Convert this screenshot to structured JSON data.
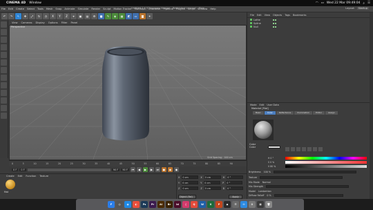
{
  "macbar": {
    "app": "CINEMA 4D",
    "menu": [
      "Window"
    ],
    "clock": "Wed 22 Mar  09:49:04",
    "icons": [
      "wifi-icon",
      "battery-icon",
      "search-icon",
      "list-icon"
    ]
  },
  "c4d": {
    "menu": [
      "File",
      "Edit",
      "Create",
      "Select",
      "Tools",
      "Mesh",
      "Snap",
      "Animate",
      "Simulate",
      "Render",
      "Sculpt",
      "Motion Tracker",
      "MoGraph",
      "Character",
      "Pipeline",
      "Plugins",
      "Script",
      "Window",
      "Help"
    ],
    "title": "Untitled 1 * (Classroom Version - Restricted License) - Main",
    "layout_label": "Layout:",
    "layout_value": "Startup"
  },
  "viewport": {
    "menu": [
      "View",
      "Cameras",
      "Display",
      "Options",
      "Filter",
      "Panel"
    ],
    "label": "Perspective",
    "grid_spacing": "Grid Spacing : 100 cm"
  },
  "timeline": {
    "ticks": [
      "0",
      "5",
      "10",
      "15",
      "20",
      "25",
      "30",
      "35",
      "40",
      "45",
      "50",
      "55",
      "60",
      "65",
      "70",
      "75",
      "80",
      "85",
      "90"
    ],
    "frame_start": "0 F",
    "frame_current": "0 F",
    "frame_end": "90 F",
    "frame_end2": "90 F"
  },
  "material_manager": {
    "menu": [
      "Create",
      "Edit",
      "Function",
      "Texture"
    ],
    "material_name": "Mat"
  },
  "coordinates": {
    "rows": [
      {
        "axis": "X",
        "pos": "0 cm",
        "rot_axis": "X",
        "rot": "0 cm",
        "h": "H",
        "hval": "0 °"
      },
      {
        "axis": "Y",
        "pos": "0 cm",
        "rot_axis": "Y",
        "rot": "0 cm",
        "h": "P",
        "hval": "0 °"
      },
      {
        "axis": "Z",
        "pos": "0 cm",
        "rot_axis": "Z",
        "rot": "0 cm",
        "h": "B",
        "hval": "0 °"
      }
    ],
    "mode": "Object (Rel)",
    "apply": "Apply"
  },
  "objects": {
    "menu": [
      "File",
      "Edit",
      "View",
      "Objects",
      "Tags",
      "Bookmarks"
    ],
    "items": [
      "Lathe",
      "Spline",
      "Null"
    ]
  },
  "attributes": {
    "menu": [
      "Mode",
      "Edit",
      "User Data"
    ],
    "title": "Material [Mat]",
    "tabs": [
      "Basic",
      "Color",
      "Reflectance",
      "Illumination",
      "Editor",
      "Assign"
    ],
    "active_tab": "Color",
    "section": "Color",
    "color_label": "Color",
    "h_label": "H",
    "h_val": "0 °",
    "s_label": "S",
    "s_val": "0 %",
    "v_label": "V",
    "v_val": "80 %",
    "brightness_label": "Brightness",
    "brightness_val": "100 %",
    "texture_label": "Texture",
    "mix_label": "Mix Mode",
    "mix_val": "Normal",
    "mixstrength_label": "Mix Strength",
    "model_label": "Model",
    "model_val": "Lambertian",
    "diffuse_label": "Diffuse Falloff",
    "diffuse_val": "0 %"
  },
  "dock": {
    "apps": [
      {
        "label": "F",
        "color": "#2b7de9",
        "name": "finder-icon"
      },
      {
        "label": "◎",
        "color": "#555",
        "name": "launchpad-icon"
      },
      {
        "label": "◉",
        "color": "#1e88e5",
        "name": "safari-icon"
      },
      {
        "label": "◐",
        "color": "#e94e3b",
        "name": "chrome-icon"
      },
      {
        "label": "Ps",
        "color": "#1c3a57",
        "name": "photoshop-icon"
      },
      {
        "label": "Pr",
        "color": "#3b1a4f",
        "name": "premiere-icon"
      },
      {
        "label": "Ai",
        "color": "#4a2a00",
        "name": "illustrator-icon"
      },
      {
        "label": "Br",
        "color": "#3a2200",
        "name": "bridge-icon"
      },
      {
        "label": "Id",
        "color": "#4a0d2a",
        "name": "indesign-icon"
      },
      {
        "label": "♫",
        "color": "#d43a6c",
        "name": "itunes-icon"
      },
      {
        "label": "Q",
        "color": "#e34a3a",
        "name": "quicktime-icon"
      },
      {
        "label": "W",
        "color": "#1f5fa8",
        "name": "word-icon"
      },
      {
        "label": "X",
        "color": "#1d6b3a",
        "name": "excel-icon"
      },
      {
        "label": "P",
        "color": "#c4461c",
        "name": "powerpoint-icon"
      },
      {
        "label": "◆",
        "color": "#2a2a2a",
        "name": "cinema4d-icon"
      },
      {
        "label": "☰",
        "color": "#6a6a6a",
        "name": "notes-icon"
      },
      {
        "label": "✉",
        "color": "#2d8ae0",
        "name": "mail-icon"
      },
      {
        "label": "⚙",
        "color": "#777",
        "name": "preferences-icon"
      },
      {
        "label": "▦",
        "color": "#3a3a3a",
        "name": "downloads-icon"
      },
      {
        "label": "🗑",
        "color": "#888",
        "name": "trash-icon"
      }
    ]
  }
}
